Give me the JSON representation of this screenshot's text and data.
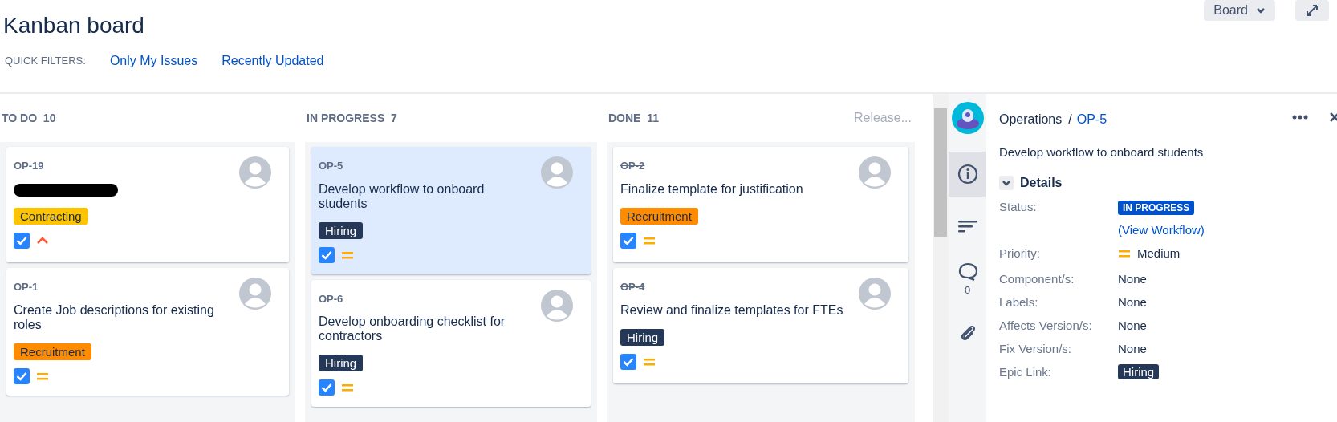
{
  "header": {
    "title": "Kanban board",
    "board_button": "Board",
    "quick_filters_label": "QUICK FILTERS:",
    "quick_filters": [
      {
        "label": "Only My Issues",
        "selected": false
      },
      {
        "label": "Recently Updated",
        "selected": false
      }
    ]
  },
  "columns": [
    {
      "title": "TO DO",
      "count": "10",
      "cards": [
        {
          "key": "OP-19",
          "summary_redacted": true,
          "label": "Contracting",
          "color": "#ffc400",
          "high_priority": true,
          "done": false,
          "selected": false
        },
        {
          "key": "OP-1",
          "summary": "Create Job descriptions for existing roles",
          "label": "Recruitment",
          "color": "#ff8b00",
          "high_priority": false,
          "done": false,
          "selected": false
        }
      ]
    },
    {
      "title": "IN PROGRESS",
      "count": "7",
      "cards": [
        {
          "key": "OP-5",
          "summary": "Develop workflow to onboard students",
          "label": "Hiring",
          "color": "#253858",
          "high_priority": false,
          "done": false,
          "selected": true
        },
        {
          "key": "OP-6",
          "summary": "Develop onboarding checklist for contractors",
          "label": "Hiring",
          "color": "#253858",
          "high_priority": false,
          "done": false,
          "selected": false
        }
      ]
    },
    {
      "title": "DONE",
      "count": "11",
      "release": "Release...",
      "cards": [
        {
          "key": "OP-2",
          "summary": "Finalize template for justification",
          "label": "Recruitment",
          "color": "#ff8b00",
          "high_priority": false,
          "done": true,
          "selected": false
        },
        {
          "key": "OP-4",
          "summary": "Review and finalize templates for FTEs",
          "label": "Hiring",
          "color": "#253858",
          "high_priority": false,
          "done": true,
          "selected": false
        }
      ]
    }
  ],
  "detail_tools": [
    {
      "kind": "info",
      "selected": true
    },
    {
      "kind": "description",
      "selected": false
    },
    {
      "kind": "comments",
      "count": "0",
      "selected": false
    },
    {
      "kind": "attachments",
      "selected": false
    }
  ],
  "detail": {
    "project": "Operations",
    "separator": "/",
    "issue_key": "OP-5",
    "summary": "Develop workflow to onboard students",
    "section": "Details",
    "expanded": true,
    "fields": [
      {
        "kind": "status",
        "label": "Status:",
        "value": "IN PROGRESS",
        "link": "(View Workflow)"
      },
      {
        "kind": "priority",
        "label": "Priority:",
        "value": "Medium",
        "high_priority": false
      },
      {
        "kind": "text",
        "label": "Component/s:",
        "value": "None"
      },
      {
        "kind": "text",
        "label": "Labels:",
        "value": "None"
      },
      {
        "kind": "text",
        "label": "Affects Version/s:",
        "value": "None"
      },
      {
        "kind": "text",
        "label": "Fix Version/s:",
        "value": "None"
      },
      {
        "kind": "epic",
        "label": "Epic Link:",
        "value": "Hiring",
        "color": "#253858"
      }
    ]
  }
}
